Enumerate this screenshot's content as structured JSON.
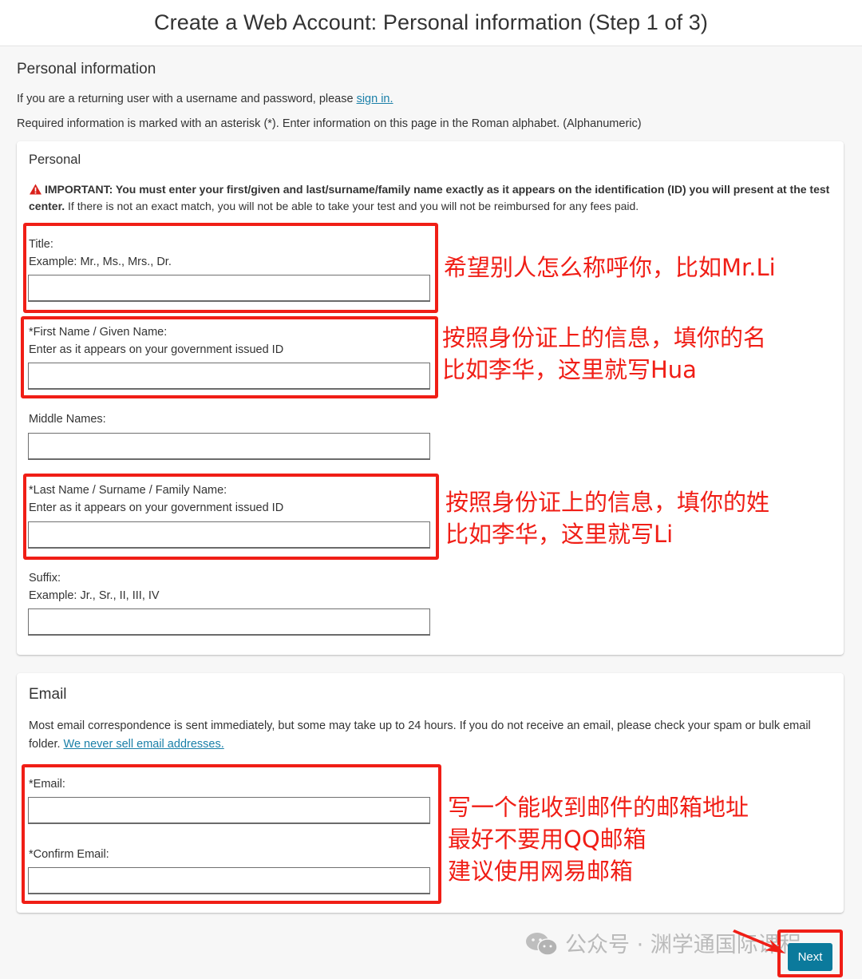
{
  "header": {
    "title": "Create a Web Account: Personal information (Step 1 of 3)"
  },
  "intro": {
    "section_title": "Personal information",
    "returning_text": "If you are a returning user with a username and password, please ",
    "sign_in_link": "sign in.",
    "required_text": "Required information is marked with an asterisk (*). Enter information on this page in the Roman alphabet. (Alphanumeric)"
  },
  "personal": {
    "title": "Personal",
    "important_bold": "IMPORTANT: You must enter your first/given and last/surname/family name exactly as it appears on the identification (ID) you will present at the test center.",
    "important_rest": " If there is not an exact match, you will not be able to take your test and you will not be reimbursed for any fees paid.",
    "fields": {
      "title": {
        "label": "Title:",
        "hint": "Example: Mr., Ms., Mrs., Dr.",
        "value": ""
      },
      "first_name": {
        "label": "*First Name / Given Name:",
        "hint": "Enter as it appears on your government issued ID",
        "value": ""
      },
      "middle_names": {
        "label": "Middle Names:",
        "value": ""
      },
      "last_name": {
        "label": "*Last Name / Surname / Family Name:",
        "hint": "Enter as it appears on your government issued ID",
        "value": ""
      },
      "suffix": {
        "label": "Suffix:",
        "hint": "Example: Jr., Sr., II, III, IV",
        "value": ""
      }
    }
  },
  "email": {
    "title": "Email",
    "description": "Most email correspondence is sent immediately, but some may take up to 24 hours. If you do not receive an email, please check your spam or bulk email folder. ",
    "never_sell_link": "We never sell email addresses.",
    "fields": {
      "email": {
        "label": "*Email:",
        "value": ""
      },
      "confirm_email": {
        "label": "*Confirm Email:",
        "value": ""
      }
    }
  },
  "annotations": {
    "title_note": "希望别人怎么称呼你，比如Mr.Li",
    "first_note_1": "按照身份证上的信息，填你的名",
    "first_note_2": "比如李华，这里就写Hua",
    "last_note_1": "按照身份证上的信息，填你的姓",
    "last_note_2": "比如李华，这里就写Li",
    "email_note_1": "写一个能收到邮件的邮箱地址",
    "email_note_2": "最好不要用QQ邮箱",
    "email_note_3": "建议使用网易邮箱",
    "color": "#f01e16"
  },
  "footer": {
    "next_label": "Next"
  },
  "watermark": {
    "text": "公众号 · 渊学通国际课程"
  },
  "colors": {
    "link": "#1a7fa8",
    "primary_button": "#0b7a9c",
    "warning": "#d9201a"
  }
}
